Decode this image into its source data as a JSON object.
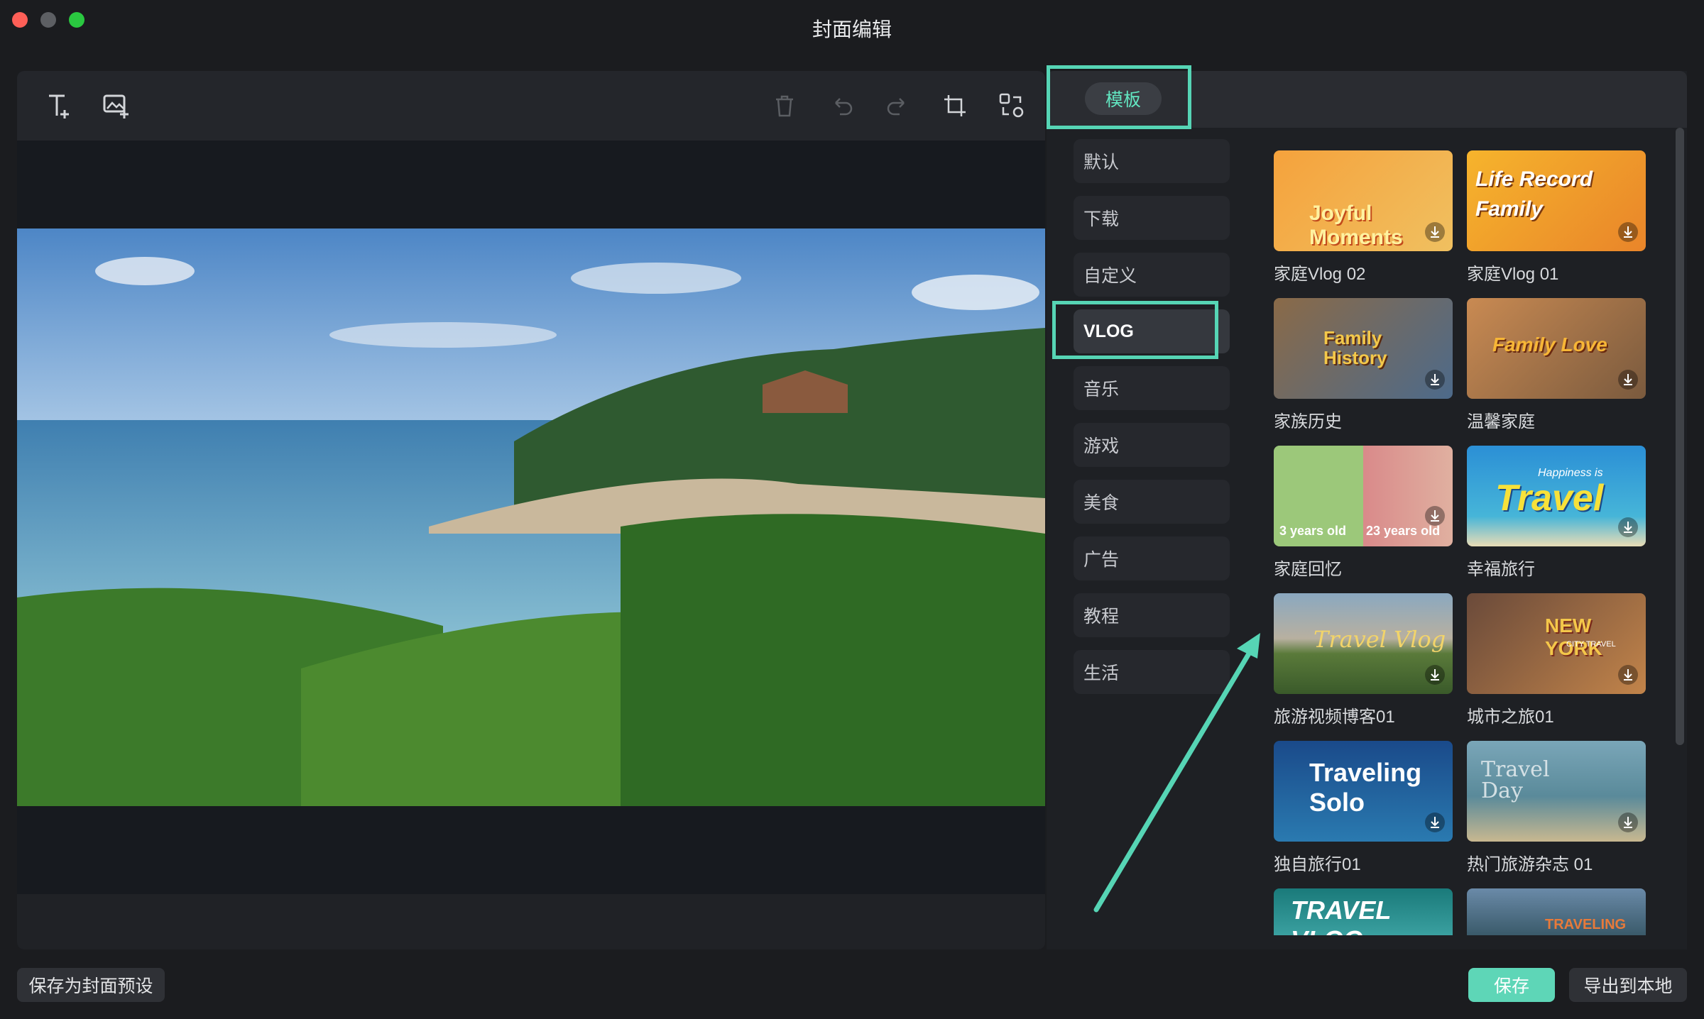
{
  "window": {
    "title": "封面编辑"
  },
  "toolbar": {
    "tools": [
      "text-add-icon",
      "image-add-icon",
      "trash-icon",
      "undo-icon",
      "redo-icon",
      "crop-icon",
      "swap-icon"
    ]
  },
  "panel": {
    "tab_label": "模板",
    "categories": [
      "默认",
      "下载",
      "自定义",
      "VLOG",
      "音乐",
      "游戏",
      "美食",
      "广告",
      "教程",
      "生活"
    ],
    "selected_category": "VLOG",
    "templates": [
      {
        "label": "家庭Vlog 02",
        "overlay": "Joyful Moments"
      },
      {
        "label": "家庭Vlog 01",
        "overlay": "Life Record Family"
      },
      {
        "label": "家族历史",
        "overlay": "Family History"
      },
      {
        "label": "温馨家庭",
        "overlay": "Family Love"
      },
      {
        "label": "家庭回忆",
        "overlay_a": "3 years old",
        "overlay_b": "23 years old"
      },
      {
        "label": "幸福旅行",
        "overlay": "Travel",
        "overlay_small": "Happiness is"
      },
      {
        "label": "旅游视频博客01",
        "overlay": "Travel Vlog"
      },
      {
        "label": "城市之旅01",
        "overlay": "NEW YORK",
        "overlay_small": "CITY TRAVEL"
      },
      {
        "label": "独自旅行01",
        "overlay": "Traveling Solo"
      },
      {
        "label": "热门旅游杂志 01",
        "overlay": "Travel Day"
      },
      {
        "label": "",
        "overlay": "TRAVEL VLOG"
      },
      {
        "label": "",
        "overlay": "TRAVELING"
      }
    ]
  },
  "footer": {
    "save_preset": "保存为封面预设",
    "save": "保存",
    "export": "导出到本地"
  },
  "colors": {
    "accent": "#5ed6b7",
    "highlight": "#56d5b5"
  }
}
